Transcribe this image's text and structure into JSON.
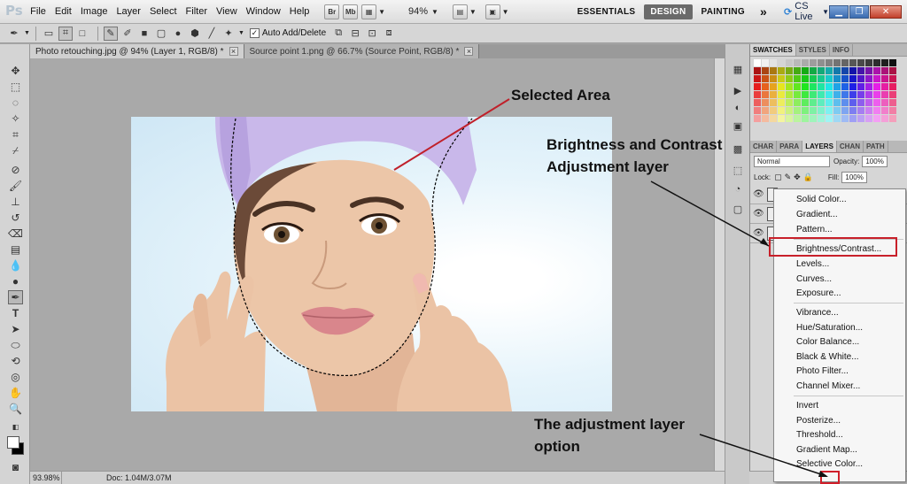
{
  "app": {
    "logo": "Ps",
    "menu": [
      "File",
      "Edit",
      "Image",
      "Layer",
      "Select",
      "Filter",
      "View",
      "Window",
      "Help"
    ],
    "mini_buttons": [
      "Br",
      "Mb"
    ],
    "zoom": "94%",
    "workspaces": [
      "ESSENTIALS",
      "DESIGN",
      "PAINTING"
    ],
    "active_workspace": "DESIGN",
    "more": "»",
    "cs_live": "CS Live"
  },
  "options_bar": {
    "auto_add_delete_label": "Auto Add/Delete",
    "auto_add_delete_checked": true
  },
  "tabs": [
    {
      "label": "Photo retouching.jpg @ 94% (Layer 1, RGB/8) *",
      "active": true
    },
    {
      "label": "Source point 1.png @ 66.7% (Source Point, RGB/8) *",
      "active": false
    }
  ],
  "status": {
    "zoom": "93.98%",
    "doc": "Doc: 1.04M/3.07M"
  },
  "panels": {
    "top_tabs": [
      "SWATCHES",
      "STYLES",
      "INFO"
    ],
    "layer_tabs": [
      "CHAR",
      "PARA",
      "LAYERS",
      "CHAN",
      "PATH"
    ],
    "active_layer_tab": "LAYERS",
    "blend_mode": "Normal",
    "opacity_label": "Opacity:",
    "opacity": "100%",
    "lock_label": "Lock:",
    "fill_label": "Fill:",
    "fill": "100%"
  },
  "adjustment_menu": {
    "groups": [
      [
        "Solid Color...",
        "Gradient...",
        "Pattern..."
      ],
      [
        "Brightness/Contrast...",
        "Levels...",
        "Curves...",
        "Exposure..."
      ],
      [
        "Vibrance...",
        "Hue/Saturation...",
        "Color Balance...",
        "Black & White...",
        "Photo Filter...",
        "Channel Mixer..."
      ],
      [
        "Invert",
        "Posterize...",
        "Threshold...",
        "Gradient Map...",
        "Selective Color..."
      ]
    ],
    "highlighted": "Brightness/Contrast..."
  },
  "annotations": {
    "selected_area": "Selected Area",
    "brightness_line1": "Brightness and Contrast",
    "brightness_line2": "Adjustment layer",
    "adjust_line1": "The adjustment layer",
    "adjust_line2": "option"
  },
  "colors": {
    "highlight_red": "#c8202a",
    "towel": "#c9b8ea",
    "skin": "#e8c2a4"
  }
}
